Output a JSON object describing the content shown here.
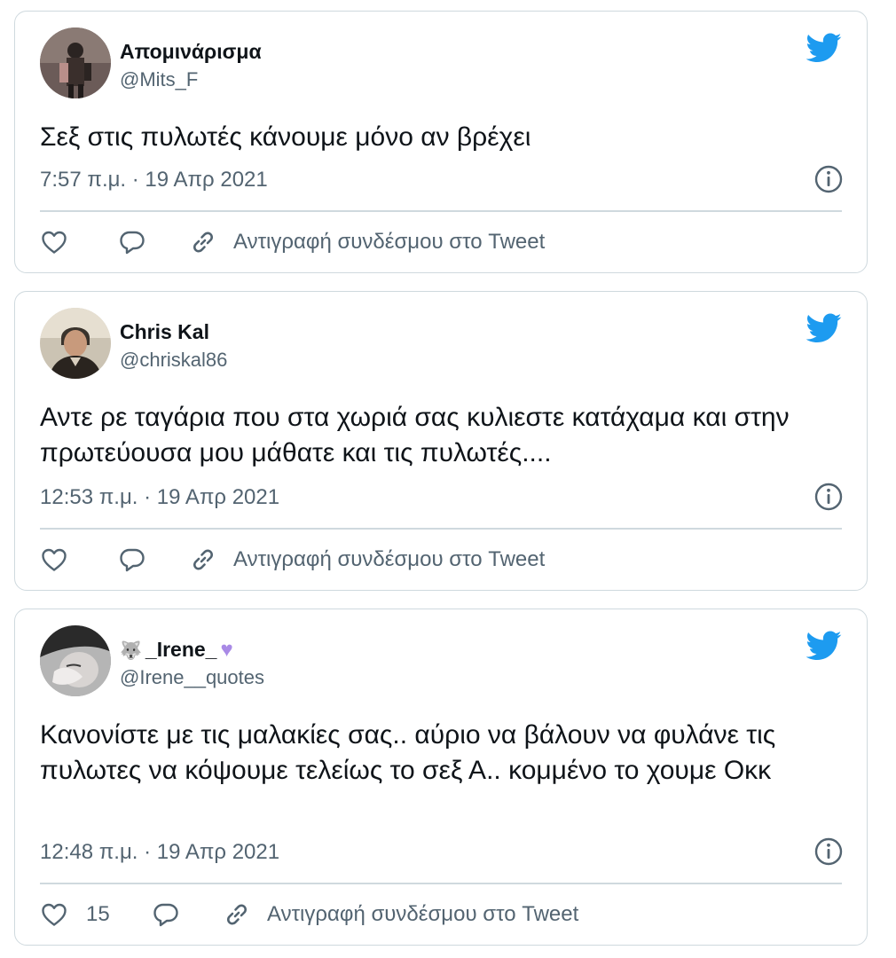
{
  "colors": {
    "twitter_blue": "#1d9bf0",
    "text_primary": "#0f1419",
    "text_secondary": "#536471",
    "border": "#cfd9de",
    "purple_heart": "#a98ae6"
  },
  "tweets": [
    {
      "display_name": "Απομινάρισμα",
      "handle": "@Mits_F",
      "text": "Σεξ στις πυλωτές κάνουμε μόνο αν βρέχει",
      "timestamp": "7:57 π.μ. · 19 Απρ 2021",
      "like_count": "",
      "copy_link_label": "Αντιγραφή συνδέσμου στο Tweet",
      "icons": [
        "twitter-bird-icon",
        "info-icon",
        "heart-icon",
        "reply-icon",
        "link-icon"
      ]
    },
    {
      "display_name": "Chris Kal",
      "handle": "@chriskal86",
      "text": "Αντε ρε ταγάρια που στα χωριά σας κυλιεστε κατάχαμα και στην πρωτεύουσα μου μάθατε και τις πυλωτές....",
      "timestamp": "12:53 π.μ. · 19 Απρ 2021",
      "like_count": "",
      "copy_link_label": "Αντιγραφή συνδέσμου στο Tweet",
      "icons": [
        "twitter-bird-icon",
        "info-icon",
        "heart-icon",
        "reply-icon",
        "link-icon"
      ]
    },
    {
      "display_name": "_Irene_",
      "name_prefix_emoji": "🐺",
      "name_suffix_emoji": "♥",
      "handle": "@Irene__quotes",
      "text": "Κανονίστε με τις μαλακίες σας..  αύριο να βάλουν να φυλάνε τις πυλωτες να κόψουμε τελείως το σεξ Α.. κομμένο το χουμε Οκκ",
      "timestamp": "12:48 π.μ. · 19 Απρ 2021",
      "like_count": "15",
      "copy_link_label": "Αντιγραφή συνδέσμου στο Tweet",
      "icons": [
        "twitter-bird-icon",
        "info-icon",
        "heart-icon",
        "reply-icon",
        "link-icon"
      ]
    }
  ]
}
